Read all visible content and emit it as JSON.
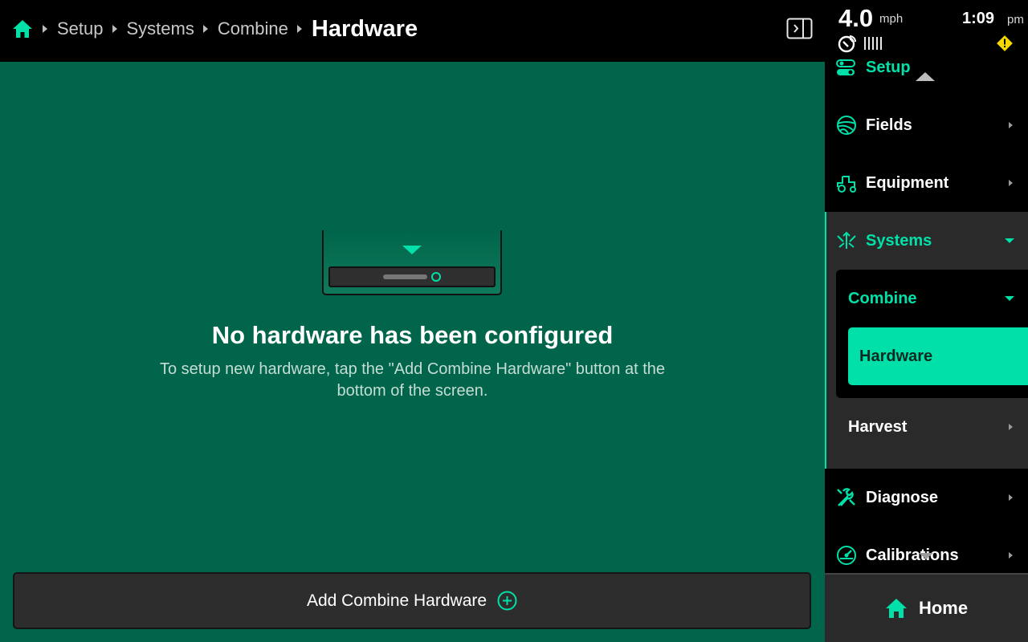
{
  "breadcrumb": {
    "items": [
      "Setup",
      "Systems",
      "Combine"
    ],
    "current": "Hardware"
  },
  "status": {
    "speed": "4.0",
    "speed_unit": "mph",
    "time": "1:09",
    "time_suffix": "pm"
  },
  "main": {
    "empty_title": "No hardware has been configured",
    "empty_body": "To setup new hardware, tap the \"Add Combine Hardware\" button at the bottom of the screen.",
    "add_button_label": "Add Combine Hardware"
  },
  "sidebar": {
    "items": {
      "setup": "Setup",
      "fields": "Fields",
      "equipment": "Equipment",
      "systems": "Systems",
      "combine": "Combine",
      "hardware": "Hardware",
      "harvest": "Harvest",
      "diagnose": "Diagnose",
      "calibrations": "Calibrations"
    },
    "home_label": "Home"
  },
  "colors": {
    "accent": "#00e0a8",
    "main_background": "#00654a",
    "panel": "#2a2a2a",
    "warning": "#f5d800"
  }
}
